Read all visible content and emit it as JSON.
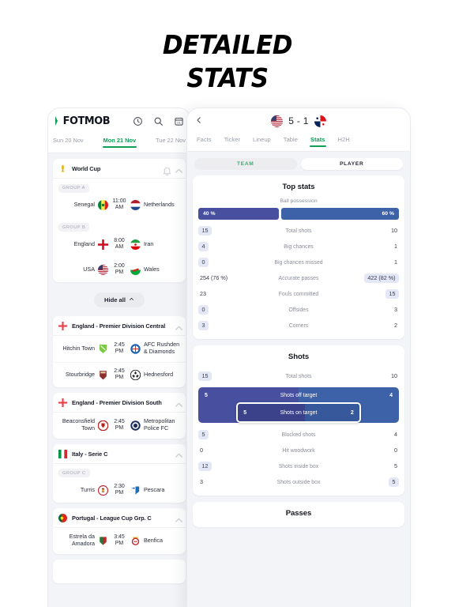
{
  "headline": {
    "line1": "DETAILED",
    "line2": "STATS"
  },
  "colors": {
    "accent_green": "#0f9d58",
    "bar_home": "#474f9e",
    "bar_away": "#3d62a8",
    "chip_bg": "#e4e7f5",
    "page_bg": "#f3f4f7"
  },
  "left_panel": {
    "logo": {
      "text": "FOTMOB",
      "mark": "bolt-icon"
    },
    "top_icons": [
      "clock-icon",
      "search-icon",
      "calendar-icon"
    ],
    "date_tabs": [
      {
        "label": "Sun 20 Nov",
        "active": false
      },
      {
        "label": "Mon 21 Nov",
        "active": true
      },
      {
        "label": "Tue 22 Nov",
        "active": false
      }
    ],
    "hide_all_label": "Hide all",
    "leagues": [
      {
        "name": "World Cup",
        "icon": "trophy-icon",
        "groups": [
          {
            "label": "GROUP A",
            "matches": [
              {
                "home": "Senegal",
                "away": "Netherlands",
                "time_top": "11:00",
                "time_bottom": "AM",
                "home_badge": "senegal-flag",
                "away_badge": "netherlands-flag"
              }
            ]
          },
          {
            "label": "GROUP B",
            "matches": [
              {
                "home": "England",
                "away": "Iran",
                "time_top": "8:00",
                "time_bottom": "AM",
                "home_badge": "england-flag",
                "away_badge": "iran-flag"
              },
              {
                "home": "USA",
                "away": "Wales",
                "time_top": "2:00",
                "time_bottom": "PM",
                "home_badge": "usa-flag",
                "away_badge": "wales-flag"
              }
            ]
          }
        ]
      },
      {
        "name": "England - Premier Division Central",
        "icon": "england-flag",
        "groups": [
          {
            "label": "",
            "matches": [
              {
                "home": "Hitchin Town",
                "away": "AFC Rushden & Diamonds",
                "time_top": "2:45",
                "time_bottom": "PM",
                "home_badge": "hitchin-crest",
                "away_badge": "rushden-crest"
              },
              {
                "home": "Stourbridge",
                "away": "Hednesford",
                "time_top": "2:45",
                "time_bottom": "PM",
                "home_badge": "stourbridge-crest",
                "away_badge": "hednesford-crest"
              }
            ]
          }
        ]
      },
      {
        "name": "England - Premier Division South",
        "icon": "england-flag",
        "groups": [
          {
            "label": "",
            "matches": [
              {
                "home": "Beaconsfield Town",
                "away": "Metropolitan Police FC",
                "time_top": "2:45",
                "time_bottom": "PM",
                "home_badge": "beaconsfield-crest",
                "away_badge": "metpolice-crest"
              }
            ]
          }
        ]
      },
      {
        "name": "Italy - Serie C",
        "icon": "italy-flag",
        "groups": [
          {
            "label": "GROUP C",
            "matches": [
              {
                "home": "Turris",
                "away": "Pescara",
                "time_top": "2:30",
                "time_bottom": "PM",
                "home_badge": "turris-crest",
                "away_badge": "pescara-crest"
              }
            ]
          }
        ]
      },
      {
        "name": "Portugal - League Cup Grp. C",
        "icon": "portugal-flag",
        "groups": [
          {
            "label": "",
            "matches": [
              {
                "home": "Estrela da Amadora",
                "away": "Benfica",
                "time_top": "3:45",
                "time_bottom": "PM",
                "home_badge": "estrela-crest",
                "away_badge": "benfica-crest"
              }
            ]
          }
        ]
      }
    ]
  },
  "right_panel": {
    "back_icon": "chevron-left-icon",
    "match": {
      "home_flag": "usa-flag",
      "away_flag": "panama-flag",
      "score": "5 - 1"
    },
    "tabs": [
      {
        "label": "Facts",
        "active": false
      },
      {
        "label": "Ticker",
        "active": false
      },
      {
        "label": "Lineup",
        "active": false
      },
      {
        "label": "Table",
        "active": false
      },
      {
        "label": "Stats",
        "active": true
      },
      {
        "label": "H2H",
        "active": false
      }
    ],
    "segments": [
      {
        "label": "TEAM",
        "selected": true
      },
      {
        "label": "PLAYER",
        "selected": false
      }
    ],
    "sections": [
      {
        "title": "Top stats",
        "possession": {
          "label": "Ball possession",
          "home_text": "40 %",
          "away_text": "60 %",
          "home_pct": 40,
          "away_pct": 60
        },
        "rows": [
          {
            "name": "Total shots",
            "home": "15",
            "away": "10",
            "home_chip": true,
            "away_chip": false
          },
          {
            "name": "Big chances",
            "home": "4",
            "away": "1",
            "home_chip": true,
            "away_chip": false
          },
          {
            "name": "Big chances missed",
            "home": "0",
            "away": "1",
            "home_chip": true,
            "away_chip": false
          },
          {
            "name": "Accurate passes",
            "home": "254 (76 %)",
            "away": "422 (82 %)",
            "home_chip": false,
            "away_chip": true
          },
          {
            "name": "Fouls committed",
            "home": "23",
            "away": "15",
            "home_chip": false,
            "away_chip": true
          },
          {
            "name": "Offsides",
            "home": "0",
            "away": "3",
            "home_chip": true,
            "away_chip": false
          },
          {
            "name": "Corners",
            "home": "3",
            "away": "2",
            "home_chip": true,
            "away_chip": false
          }
        ]
      },
      {
        "title": "Shots",
        "rows_top": [
          {
            "name": "Total shots",
            "home": "15",
            "away": "10",
            "home_chip": true,
            "away_chip": false
          }
        ],
        "grouped_bar": {
          "outer": {
            "name": "Shots off target",
            "home": "5",
            "away": "4",
            "home_pct": 50
          },
          "inner": {
            "name": "Shots on target",
            "home": "5",
            "away": "2",
            "home_pct": 55
          }
        },
        "rows_bottom": [
          {
            "name": "Blocked shots",
            "home": "5",
            "away": "4",
            "home_chip": true,
            "away_chip": false
          },
          {
            "name": "Hit woodwork",
            "home": "0",
            "away": "0",
            "home_chip": false,
            "away_chip": false
          },
          {
            "name": "Shots inside box",
            "home": "12",
            "away": "5",
            "home_chip": true,
            "away_chip": false
          },
          {
            "name": "Shots outside box",
            "home": "3",
            "away": "5",
            "home_chip": false,
            "away_chip": true
          }
        ]
      },
      {
        "title": "Passes",
        "rows": []
      }
    ]
  }
}
